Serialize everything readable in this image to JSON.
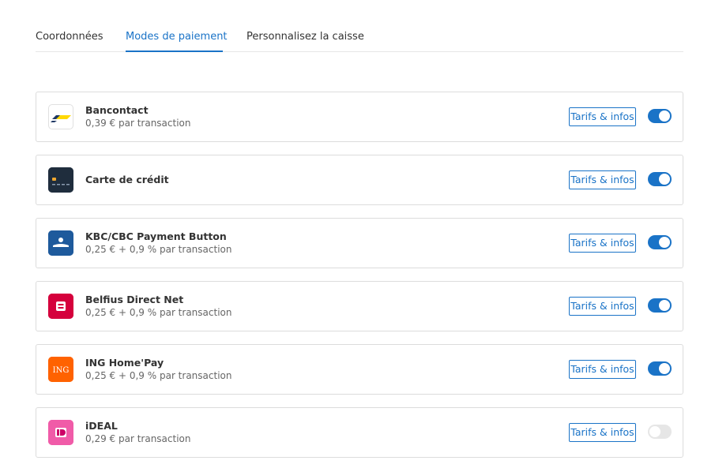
{
  "tabs": [
    {
      "label": "Coordonnées",
      "active": false
    },
    {
      "label": "Modes de paiement",
      "active": true
    },
    {
      "label": "Personnalisez la caisse",
      "active": false
    }
  ],
  "colors": {
    "accent": "#1a73c7",
    "toggle_off": "#e6e6e6"
  },
  "methods": [
    {
      "name": "Bancontact",
      "fee": "0,39 € par transaction",
      "button": "Tarifs & infos",
      "enabled": true,
      "icon": "bancontact-logo"
    },
    {
      "name": "Carte de crédit",
      "fee": "",
      "button": "Tarifs & infos",
      "enabled": true,
      "icon": "credit-card-logo"
    },
    {
      "name": "KBC/CBC Payment Button",
      "fee": "0,25 € + 0,9 % par transaction",
      "button": "Tarifs & infos",
      "enabled": true,
      "icon": "kbc-logo"
    },
    {
      "name": "Belfius Direct Net",
      "fee": "0,25 € + 0,9 % par transaction",
      "button": "Tarifs & infos",
      "enabled": true,
      "icon": "belfius-logo"
    },
    {
      "name": "ING Home'Pay",
      "fee": "0,25 € + 0,9 % par transaction",
      "button": "Tarifs & infos",
      "enabled": true,
      "icon": "ing-logo",
      "logo_text": "ING"
    },
    {
      "name": "iDEAL",
      "fee": "0,29 € par transaction",
      "button": "Tarifs & infos",
      "enabled": false,
      "icon": "ideal-logo"
    }
  ]
}
